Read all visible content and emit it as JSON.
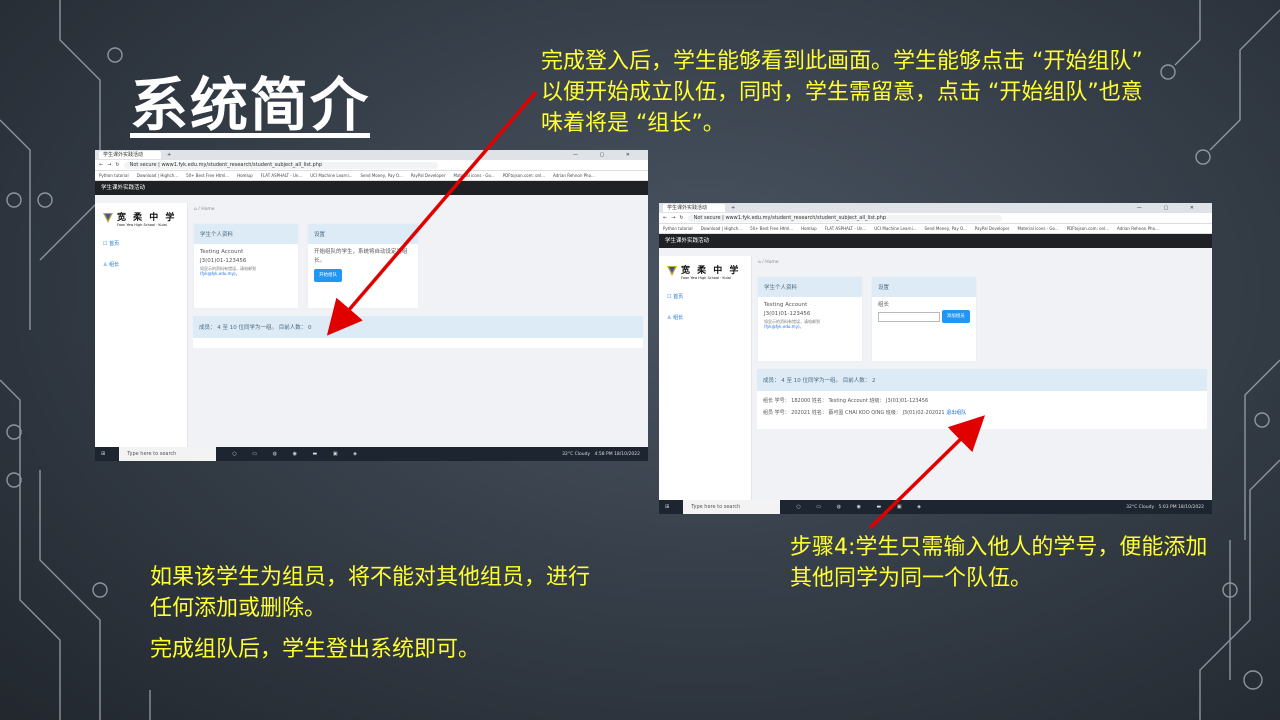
{
  "slide": {
    "title": "系统简介",
    "note_top_right": "完成登入后，学生能够看到此画面。学生能够点击 “开始组队” 以便开始成立队伍，同时，学生需留意，点击 “开始组队”也意味着将是 “组长”。",
    "note_bottom_right": "步骤4:学生只需输入他人的学号，便能添加其他同学为同一个队伍。",
    "note_bottom_left_1": "如果该学生为组员，将不能对其他组员，进行任何添加或删除。",
    "note_bottom_left_2": "完成组队后，学生登出系统即可。"
  },
  "colors": {
    "note_text": "#ffff33",
    "arrow": "#e00000",
    "app_topbar": "#202124",
    "card_header": "#dcebf5",
    "button": "#2196f3"
  },
  "screenshot1": {
    "tab_title": "学生课外实践活动",
    "new_tab": "+",
    "window_controls": "— ▢ ✕",
    "url": "Not secure | www1.fyk.edu.my/student_research/student_subject_all_list.php",
    "bookmarks": [
      "Python tutorial",
      "Download | Highch...",
      "50+ Best Free Html...",
      "Homlup",
      "FLAT ASPHALT - Un...",
      "UCI Machine Learni...",
      "Send Money, Pay O...",
      "PayPal Developer",
      "Material icons - Go...",
      "PDFtojson.com: onl...",
      "Adrian Rehnon Pho..."
    ],
    "app_title": "学生课外实践活动",
    "school_name": "宽 柔 中 学",
    "school_sub": "Foon Yew High School · Kulai",
    "nav": [
      "首页",
      "组长"
    ],
    "breadcrumb": "Home",
    "profile_header": "学生个人资料",
    "profile_name": "Testing Account",
    "profile_id": "J3(01)01-123456",
    "profile_note": "如显示的资料有错误，请电邮到",
    "profile_email": "(fyk@fyk.edu.my)。",
    "settings_header": "设置",
    "settings_text": "开始组队的学生，系统将自动设定为组长。",
    "start_button": "开始组队",
    "member_info": "成员： 4 至 10 位同学为一组。 目前人数： 0",
    "taskbar_search": "Type here to search",
    "taskbar_weather": "32°C Cloudy",
    "taskbar_time": "4:58 PM",
    "taskbar_date": "18/10/2022"
  },
  "screenshot2": {
    "tab_title": "学生课外实践活动",
    "new_tab": "+",
    "window_controls": "— ▢ ✕",
    "url": "Not secure | www1.fyk.edu.my/student_research/student_subject_all_list.php",
    "bookmarks": [
      "Python tutorial",
      "Download | Highch...",
      "50+ Best Free Html...",
      "Homlup",
      "FLAT ASPHALT - Un...",
      "UCI Machine Learni...",
      "Send Money, Pay O...",
      "PayPal Developer",
      "Material icons - Go...",
      "PDFtojson.com: onl...",
      "Adrian Rehnon Pho..."
    ],
    "app_title": "学生课外实践活动",
    "school_name": "宽 柔 中 学",
    "school_sub": "Foon Yew High School · Kulai",
    "nav": [
      "首页",
      "组长"
    ],
    "breadcrumb": "Home",
    "profile_header": "学生个人资料",
    "profile_name": "Testing Account",
    "profile_id": "J3(01)01-123456",
    "profile_note": "如显示的资料有错误，请电邮到",
    "profile_email": "(fyk@fyk.edu.my)。",
    "settings_header": "设置",
    "settings_label": "组长",
    "add_button": "添加组员",
    "member_info": "成员： 4 至 10 位同学为一组。 目前人数： 2",
    "leader_row": "组长 学号： 182000 姓名： Testing Account 班级： J3(01)01-123456",
    "member_row": "组员 学号： 202021 姓名： 蔡可盈 CHAI KOO QING 班级： J3(01)02-202021",
    "remove_link": "退出组队",
    "taskbar_search": "Type here to search",
    "taskbar_weather": "32°C Cloudy",
    "taskbar_time": "5:03 PM",
    "taskbar_date": "18/10/2022"
  }
}
